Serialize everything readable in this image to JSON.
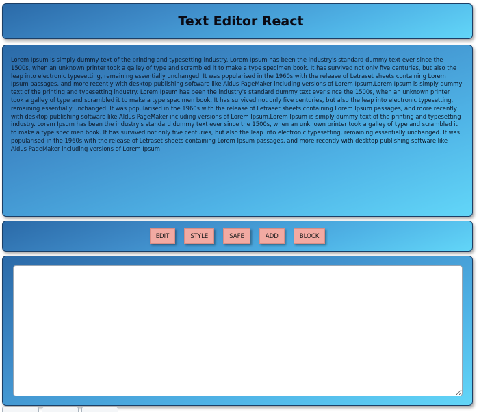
{
  "header": {
    "title": "Text Editor React"
  },
  "preview": {
    "text": "Lorem Ipsum is simply dummy text of the printing and typesetting industry. Lorem Ipsum has been the industry's standard dummy text ever since the 1500s, when an unknown printer took a galley of type and scrambled it to make a type specimen book. It has survived not only five centuries, but also the leap into electronic typesetting, remaining essentially unchanged. It was popularised in the 1960s with the release of Letraset sheets containing Lorem Ipsum passages, and more recently with desktop publishing software like Aldus PageMaker including versions of Lorem Ipsum.Lorem Ipsum is simply dummy text of the printing and typesetting industry. Lorem Ipsum has been the industry's standard dummy text ever since the 1500s, when an unknown printer took a galley of type and scrambled it to make a type specimen book. It has survived not only five centuries, but also the leap into electronic typesetting, remaining essentially unchanged. It was popularised in the 1960s with the release of Letraset sheets containing Lorem Ipsum passages, and more recently with desktop publishing software like Aldus PageMaker including versions of Lorem Ipsum.Lorem Ipsum is simply dummy text of the printing and typesetting industry. Lorem Ipsum has been the industry's standard dummy text ever since the 1500s, when an unknown printer took a galley of type and scrambled it to make a type specimen book. It has survived not only five centuries, but also the leap into electronic typesetting, remaining essentially unchanged. It was popularised in the 1960s with the release of Letraset sheets containing Lorem Ipsum passages, and more recently with desktop publishing software like Aldus PageMaker including versions of Lorem Ipsum"
  },
  "toolbar": {
    "edit_label": "EDIT",
    "style_label": "STYLE",
    "safe_label": "SAFE",
    "add_label": "ADD",
    "block_label": "BLOCK"
  },
  "editor": {
    "value": ""
  },
  "colors": {
    "panel_gradient_start": "#2b6aa8",
    "panel_gradient_end": "#62d6f8",
    "button_fill": "#f2aaa2"
  }
}
